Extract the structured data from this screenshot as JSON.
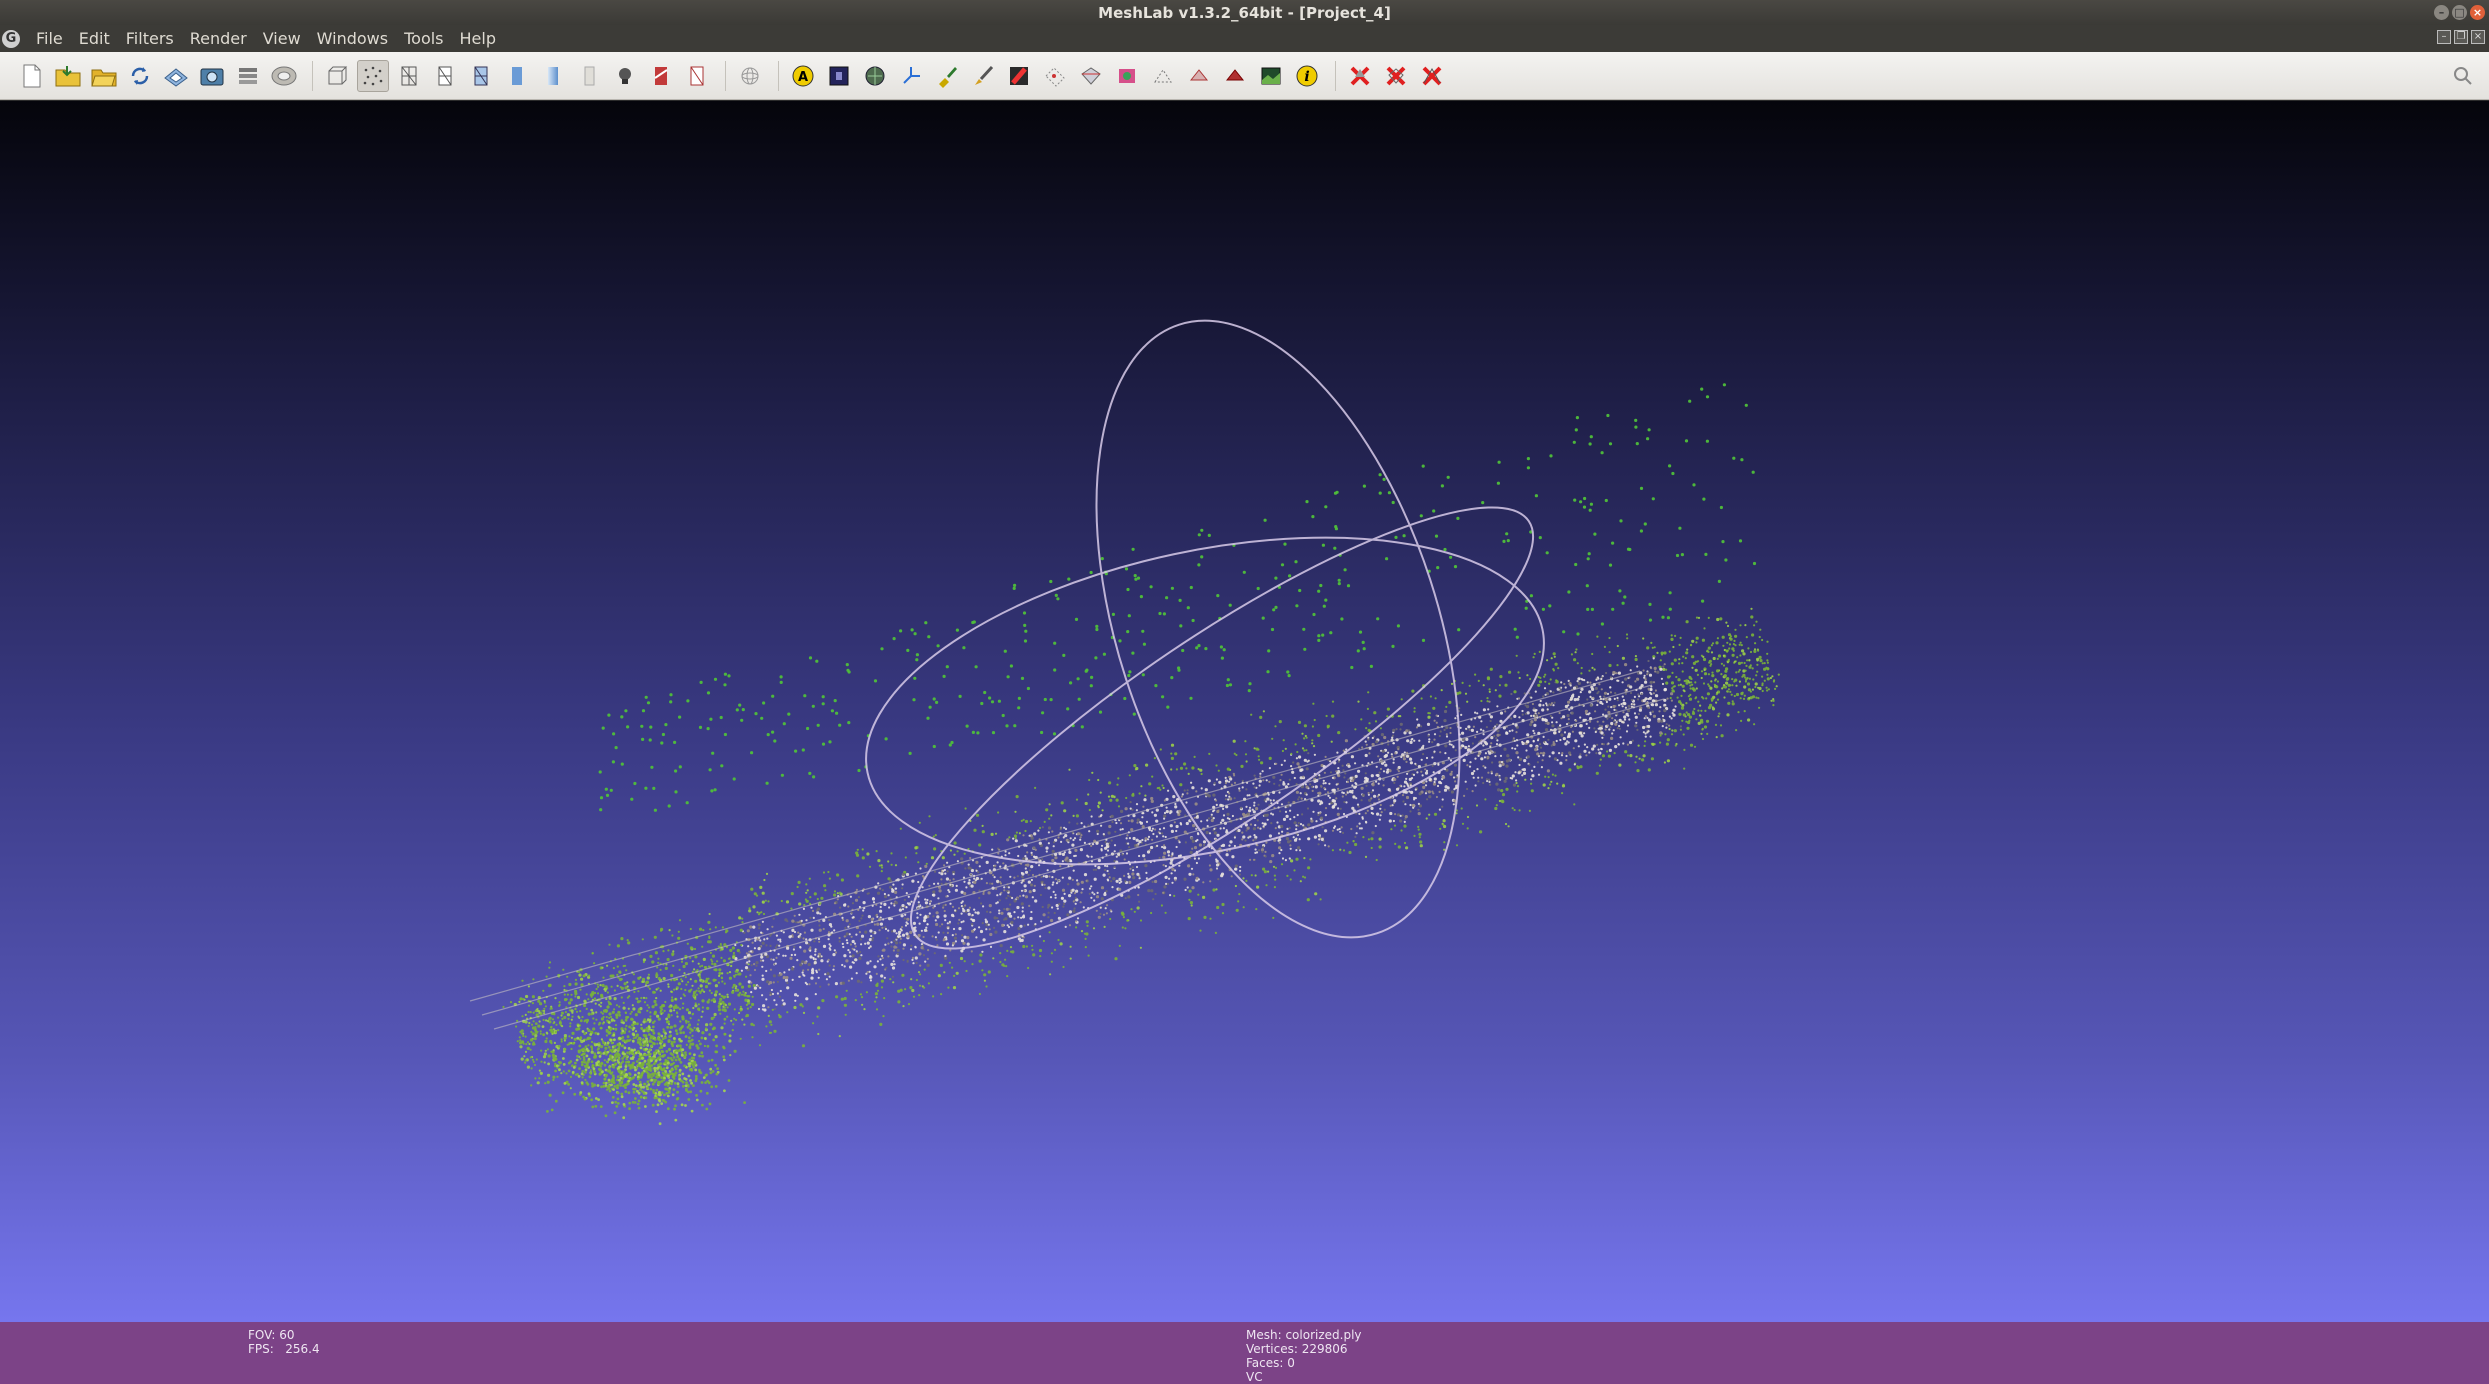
{
  "window": {
    "title": "MeshLab v1.3.2_64bit - [Project_4]"
  },
  "menu": [
    {
      "label": "File"
    },
    {
      "label": "Edit"
    },
    {
      "label": "Filters"
    },
    {
      "label": "Render"
    },
    {
      "label": "View"
    },
    {
      "label": "Windows"
    },
    {
      "label": "Tools"
    },
    {
      "label": "Help"
    }
  ],
  "toolbar": {
    "groups": [
      [
        "new-project",
        "import-mesh",
        "open-project",
        "reload",
        "save-mesh",
        "snapshot",
        "layers",
        "zoom-fit"
      ],
      [
        "bounding-box",
        "points",
        "wireframe",
        "hidden-lines",
        "flat-lines",
        "flat",
        "smooth",
        "texture",
        "light",
        "fancy-light",
        "double-light"
      ],
      [
        "trackball"
      ],
      [
        "annotate",
        "measure-image",
        "mesh-select",
        "axes",
        "paint",
        "brush",
        "red-texture",
        "select-vertex",
        "select-face",
        "select-connected",
        "align",
        "pick-points",
        "pick-faces",
        "raster",
        "info"
      ],
      [
        "delete",
        "delete-faces",
        "delete-vertices"
      ]
    ]
  },
  "viewport": {
    "colors": {
      "gradient_top": "#05050b",
      "gradient_bottom": "#7676ee",
      "trackball": "#d6c8ea",
      "vegetation": "#7ab33a",
      "buildings": "#e8e2dc"
    }
  },
  "info": {
    "fov_label": "FOV:",
    "fov_value": "60",
    "fps_label": "FPS:",
    "fps_value": "256.4",
    "mesh_line": "Mesh: colorized.ply",
    "vertices_line": "Vertices: 229806",
    "faces_line": "Faces: 0",
    "extra_line": "VC"
  }
}
